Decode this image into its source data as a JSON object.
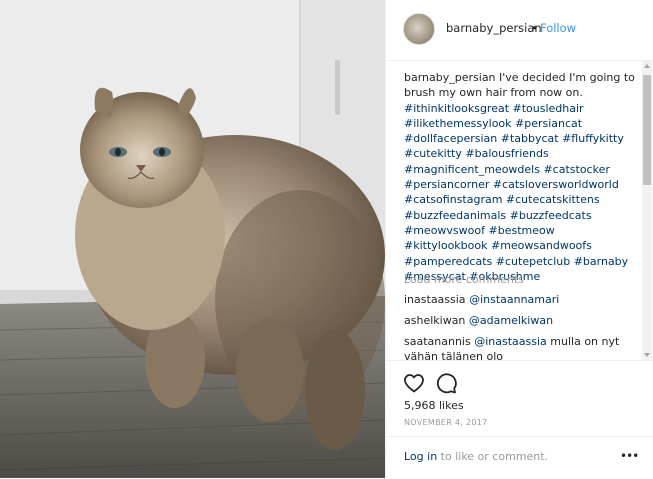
{
  "post": {
    "username": "barnaby_persian",
    "separator": "•",
    "follow_label": "Follow"
  },
  "caption": {
    "username": "barnaby_persian",
    "text": " I've decided I'm going to brush my own hair from now on. ",
    "hashtags": "#ithinkitlooksgreat #tousledhair #ilikethemessylook #persiancat #dollfacepersian #tabbycat #fluffykitty #cutekitty #balousfriends #magnificent_meowdels #catstocker #persiancorner #catsloversworldworld #catsofinstagram #cutecatskittens #buzzfeedanimals #buzzfeedcats #meowvswoof #bestmeow #kittylookbook #meowsandwoofs #pamperedcats #cutepetclub #barnaby #messycat #okbrushme"
  },
  "load_more_label": "Load more comments",
  "comments": [
    {
      "user": "inastaassia",
      "mention": "@instaannamari",
      "text": ""
    },
    {
      "user": "ashelkiwan",
      "mention": "@adamelkiwan",
      "text": ""
    },
    {
      "user": "saatanannis",
      "mention": "@inastaassia",
      "text": " mulla on nyt vähän tälänen olo"
    }
  ],
  "likes_label": "5,968 likes",
  "date_label": "NOVEMBER 4, 2017",
  "footer": {
    "login_link": "Log in",
    "login_rest": " to like or comment.",
    "more_label": "•••"
  },
  "icons": {
    "like": "heart-icon",
    "comment": "comment-bubble-icon",
    "more": "more-options-icon"
  },
  "colors": {
    "link_blue": "#3897f0",
    "hashtag": "#003569",
    "muted": "#999999",
    "text": "#262626"
  }
}
